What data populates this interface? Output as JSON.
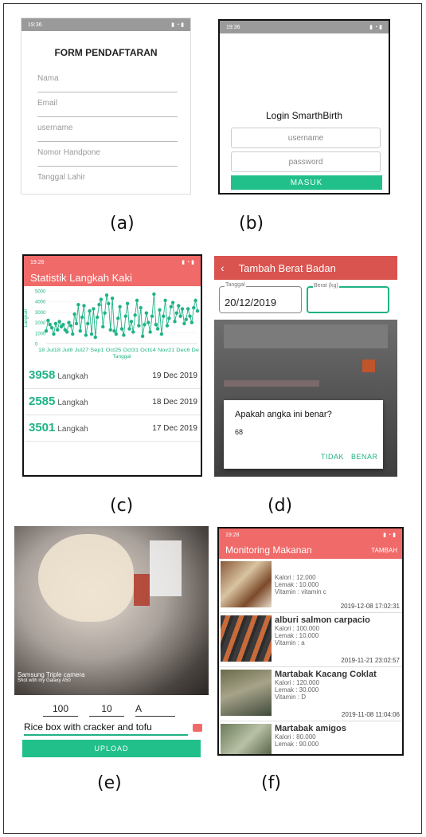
{
  "captions": [
    "(a)",
    "(b)",
    "(c)",
    "(d)",
    "(e)",
    "(f)"
  ],
  "screen_a": {
    "status_time": "19:36",
    "title": "FORM PENDAFTARAN",
    "fields": [
      "Nama",
      "Email",
      "username",
      "Nomor Handpone",
      "Tanggal Lahir"
    ]
  },
  "screen_b": {
    "status_time": "19:36",
    "title": "Login SmarthBirth",
    "username_placeholder": "username",
    "password_placeholder": "password",
    "button": "MASUK"
  },
  "screen_c": {
    "status_time": "19:26",
    "title": "Statistik Langkah Kaki",
    "rows": [
      {
        "value": "3958",
        "unit": "Langkah",
        "date": "19 Dec 2019"
      },
      {
        "value": "2585",
        "unit": "Langkah",
        "date": "18 Dec 2019"
      },
      {
        "value": "3501",
        "unit": "Langkah",
        "date": "17 Dec 2019"
      }
    ]
  },
  "chart_data": {
    "type": "line",
    "xlabel": "Tanggal",
    "ylabel": "Langkah",
    "ylim": [
      0,
      5000
    ],
    "y_ticks": [
      "5000",
      "4000",
      "3000",
      "2000",
      "1000",
      "0"
    ],
    "x_tick_labels": "18 Jul18 Jul8 Jul27 Sep1 Oct25 Oct31 Oct14 Nov21 Dec6 De",
    "series": [
      {
        "color": "#1fb386",
        "values": [
          1200,
          2200,
          1800,
          1500,
          900,
          1900,
          1300,
          2100,
          1600,
          1800,
          1300,
          1100,
          2000,
          1700,
          900,
          2800,
          1900,
          3700,
          1200,
          2500,
          3600,
          800,
          1900,
          3100,
          900,
          3300,
          600,
          2500,
          3700,
          4200,
          1600,
          2900,
          4600,
          3800,
          1300,
          4300,
          1200,
          900,
          2400,
          3500,
          1400,
          800,
          2600,
          3800,
          1400,
          2100,
          1100,
          2700,
          4100,
          1700,
          3400,
          700,
          1800,
          2900,
          2000,
          1100,
          2600,
          4700,
          1800,
          1400,
          3200,
          900,
          2600,
          4100,
          1700,
          2400,
          3500,
          3900,
          2100,
          2900,
          3600,
          2600,
          3300,
          1900,
          2300,
          3300,
          2600,
          2000,
          3400,
          4100,
          3100
        ]
      }
    ]
  },
  "screen_d": {
    "title": "Tambah Berat Badan",
    "date_label": "Tanggal",
    "date_value": "20/12/2019",
    "weight_label": "Berat (kg)",
    "dialog_title": "Apakah angka ini benar?",
    "dialog_value": "68",
    "btn_no": "TIDAK",
    "btn_yes": "BENAR"
  },
  "screen_e": {
    "watermark_title": "Samsung Triple camera",
    "watermark_sub": "Shot with my Galaxy A50",
    "input1": "100",
    "input2": "10",
    "input3": "A",
    "description": "Rice box with cracker and tofu",
    "button": "UPLOAD"
  },
  "screen_f": {
    "status_time": "19:28",
    "title": "Monitoring Makanan",
    "action": "TAMBAH",
    "items": [
      {
        "name": "",
        "lines": [
          "Kalori : 12.000",
          "Lemak : 10.000",
          "Vitamin : vitamin c"
        ],
        "date": "2019-12-08 17:02:31"
      },
      {
        "name": "alburi salmon carpacio",
        "lines": [
          "Kalori : 100.000",
          "Lemak : 10.000",
          "Vitamin : a"
        ],
        "date": "2019-11-21 23:02:57"
      },
      {
        "name": "Martabak Kacang Coklat",
        "lines": [
          "Kalori : 120.000",
          "Lemak : 30.000",
          "Vitamin : D"
        ],
        "date": "2019-11-08 11:04:06"
      },
      {
        "name": "Martabak amigos",
        "lines": [
          "Kalori : 80.000",
          "Lemak : 90.000"
        ],
        "date": ""
      }
    ]
  }
}
